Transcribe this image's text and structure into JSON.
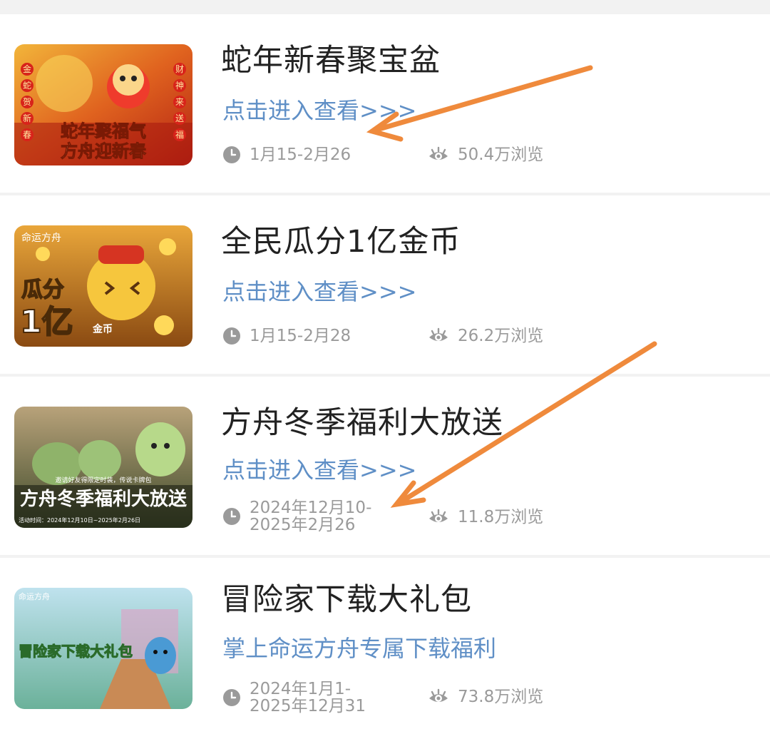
{
  "cards": [
    {
      "title": "蛇年新春聚宝盆",
      "link": "点击进入查看>>>",
      "date": "1月15-2月26",
      "views": "50.4万浏览",
      "thumb_text": [
        "蛇年聚福气",
        "方舟迎新春"
      ],
      "thumb_side_left": [
        "金",
        "蛇",
        "贺",
        "新",
        "春"
      ],
      "thumb_side_right": [
        "财",
        "神",
        "来",
        "送",
        "福"
      ]
    },
    {
      "title": "全民瓜分1亿金币",
      "link": "点击进入查看>>>",
      "date": "1月15-2月28",
      "views": "26.2万浏览",
      "thumb_text": [
        "命运方舟",
        "瓜分",
        "1亿",
        "金币"
      ]
    },
    {
      "title": "方舟冬季福利大放送",
      "link": "点击进入查看>>>",
      "date": "2024年12月10-2025年2月26",
      "views": "11.8万浏览",
      "thumb_text": [
        "邀请好友得限定时装，传说卡牌包",
        "方舟冬季福利大放送",
        "活动时间：2024年12月10日~2025年2月26日"
      ]
    },
    {
      "title": "冒险家下载大礼包",
      "link": "掌上命运方舟专属下载福利",
      "date": "2024年1月1-2025年12月31",
      "views": "73.8万浏览",
      "thumb_text": [
        "命运方舟",
        "冒险家下载大礼包"
      ]
    }
  ],
  "colors": {
    "title": "#222222",
    "link": "#5f8fc6",
    "meta": "#9a9a9a",
    "arrow": "#ef8a3c",
    "divider": "#f2f2f2"
  },
  "icons": {
    "date": "clock-icon",
    "views": "eye-icon"
  }
}
